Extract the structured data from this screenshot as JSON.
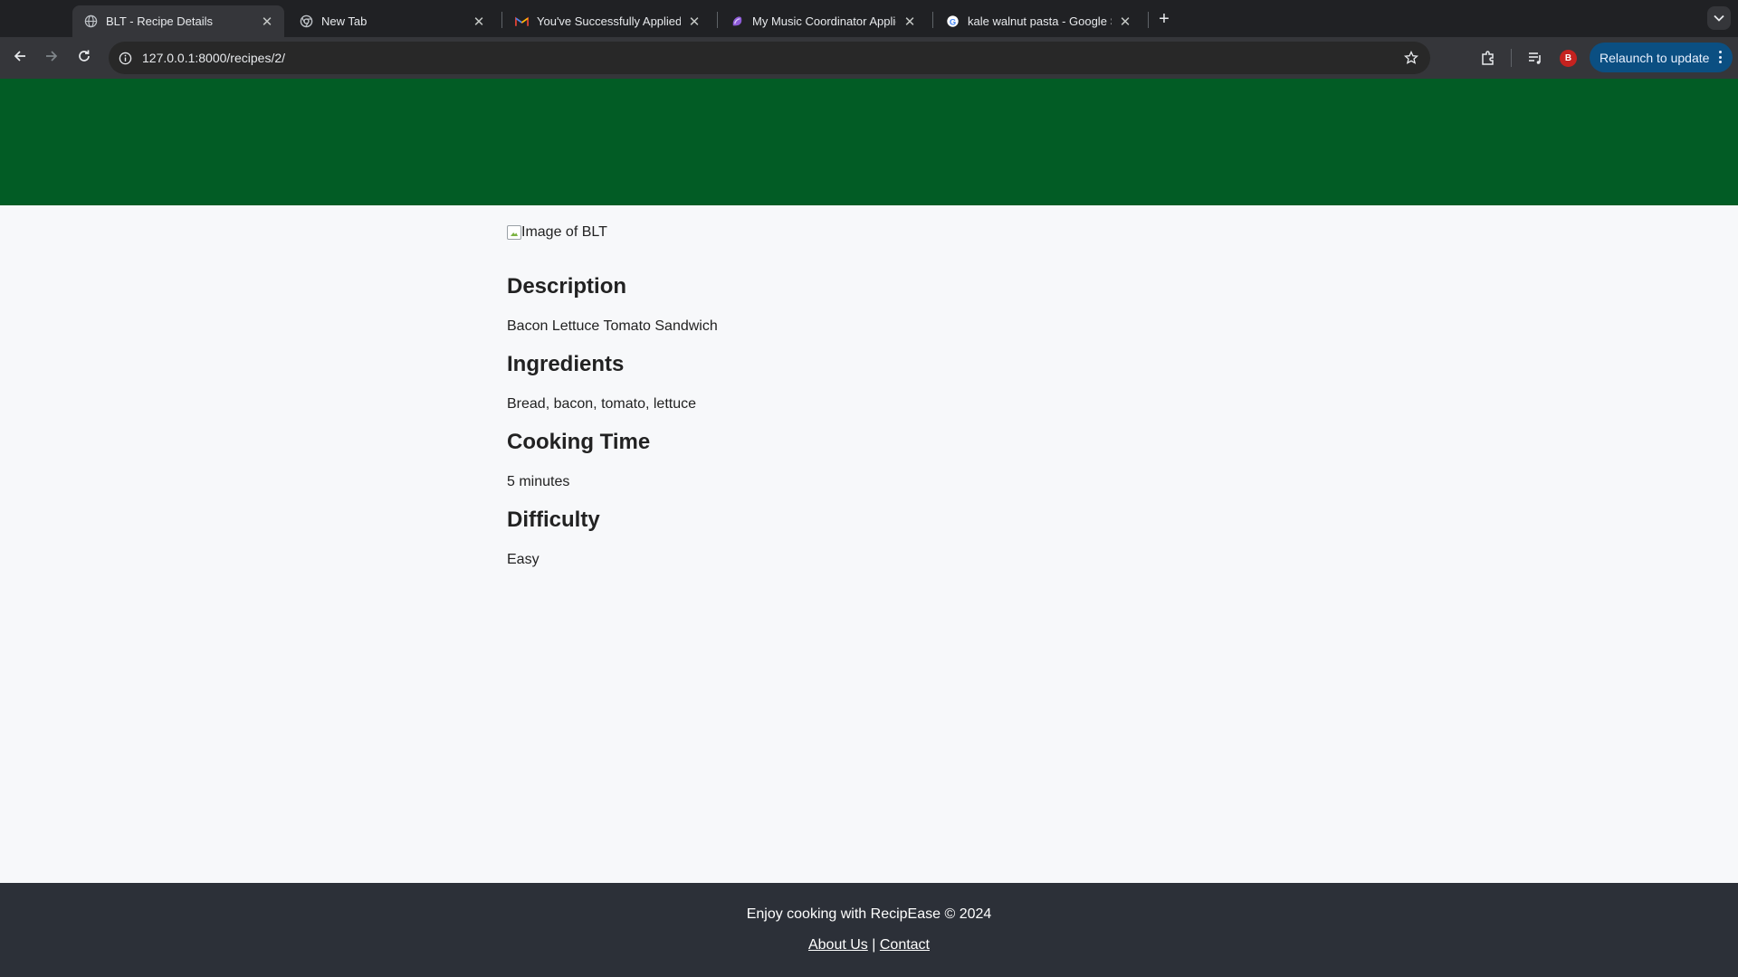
{
  "browser": {
    "tabs": [
      {
        "title": "BLT - Recipe Details",
        "icon": "globe-icon",
        "active": true
      },
      {
        "title": "New Tab",
        "icon": "chrome-icon",
        "active": false
      },
      {
        "title": "You've Successfully Applied t",
        "icon": "gmail-icon",
        "active": false
      },
      {
        "title": "My Music Coordinator Applic",
        "icon": "app-icon",
        "active": false
      },
      {
        "title": "kale walnut pasta - Google Se",
        "icon": "google-icon",
        "active": false
      }
    ],
    "url": "127.0.0.1:8000/recipes/2/",
    "profile_initial": "B",
    "relaunch_label": "Relaunch to update"
  },
  "recipe": {
    "image_alt": "Image of BLT",
    "sections": [
      {
        "heading": "Description",
        "text": "Bacon Lettuce Tomato Sandwich"
      },
      {
        "heading": "Ingredients",
        "text": "Bread, bacon, tomato, lettuce"
      },
      {
        "heading": "Cooking Time",
        "text": "5 minutes"
      },
      {
        "heading": "Difficulty",
        "text": "Easy"
      }
    ]
  },
  "footer": {
    "text": "Enjoy cooking with RecipEase © 2024",
    "about_label": "About Us",
    "separator": "|",
    "contact_label": "Contact"
  },
  "colors": {
    "header_band": "#025c25",
    "footer_bg": "#2c3038",
    "page_bg": "#f7f8fa",
    "relaunch_bg": "#0b4f82"
  }
}
